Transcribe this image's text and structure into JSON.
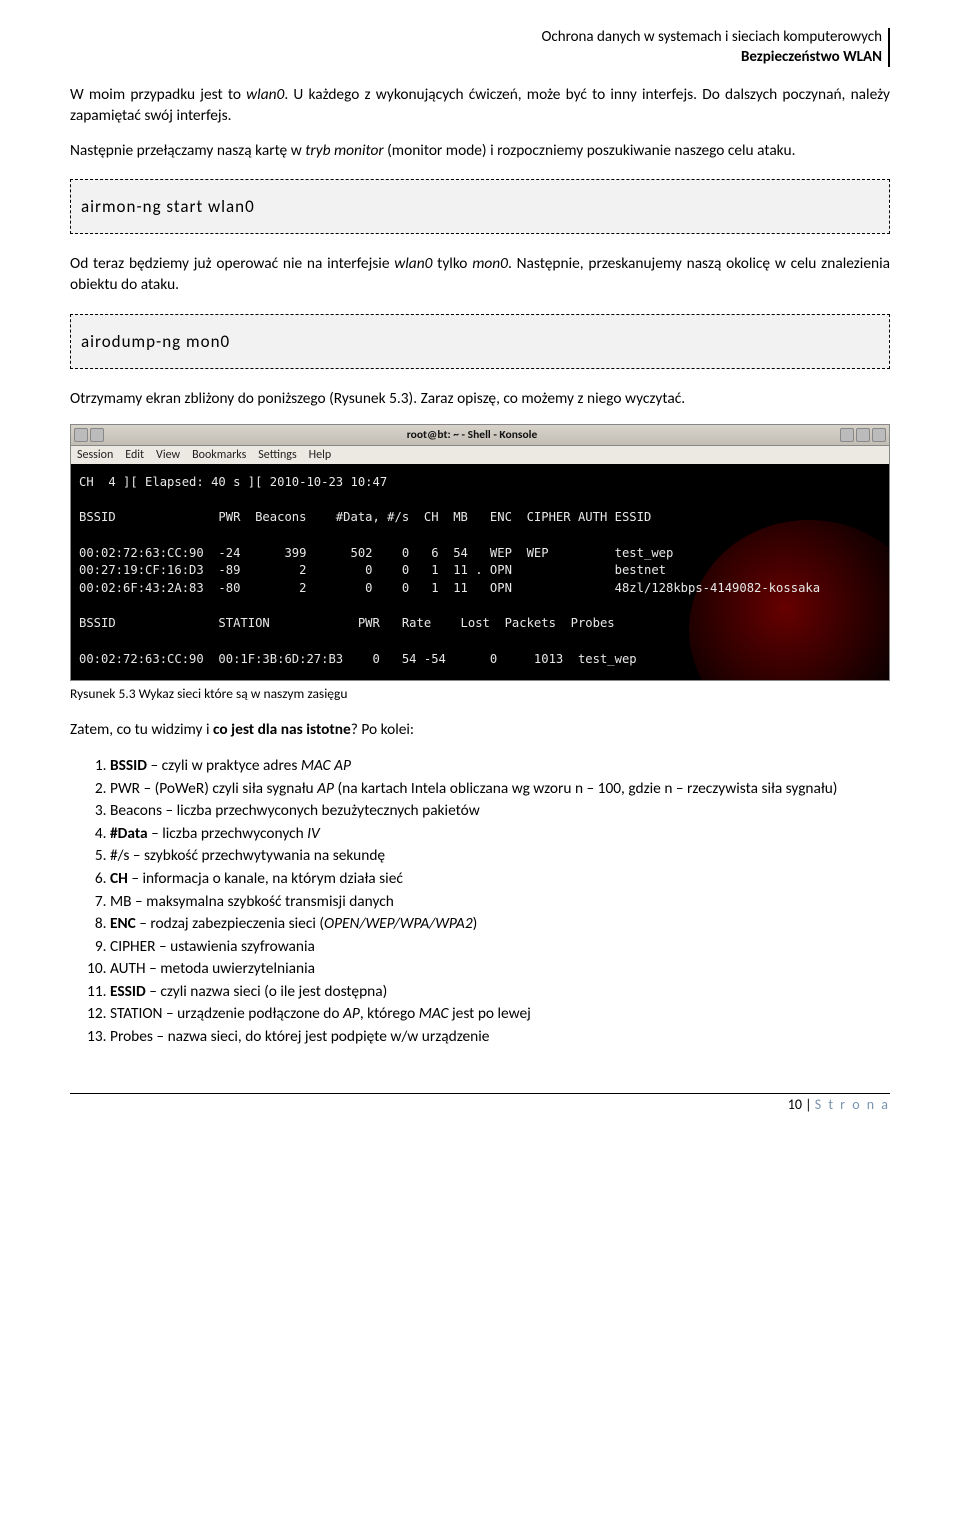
{
  "header": {
    "line1": "Ochrona danych w systemach i sieciach komputerowych",
    "line2": "Bezpieczeństwo WLAN"
  },
  "p1_a": "W moim przypadku jest to ",
  "p1_wlan": "wlan0",
  "p1_b": ". U każdego z wykonujących ćwiczeń, może być to inny interfejs. Do dalszych poczynań, należy zapamiętać swój interfejs.",
  "p2_a": "Następnie przełączamy naszą kartę w ",
  "p2_tryb": "tryb monitor",
  "p2_b": " (monitor mode) i rozpoczniemy poszukiwanie naszego celu ataku.",
  "code1": "airmon-ng  start  wlan0",
  "p3_a": "Od teraz będziemy już operować nie na interfejsie ",
  "p3_wlan": "wlan0",
  "p3_b": " tylko ",
  "p3_mon": "mon0",
  "p3_c": ". Następnie, przeskanujemy naszą okolicę w celu znalezienia obiektu do ataku.",
  "code2": "airodump-ng  mon0",
  "p4": "Otrzymamy ekran zbliżony do poniższego (Rysunek 5.3). Zaraz opiszę, co możemy z niego wyczytać.",
  "titlebar_text": "root@bt: ~ - Shell - Konsole",
  "menubar": [
    "Session",
    "Edit",
    "View",
    "Bookmarks",
    "Settings",
    "Help"
  ],
  "terminal_lines": [
    "CH  4 ][ Elapsed: 40 s ][ 2010-10-23 10:47",
    "",
    "BSSID              PWR  Beacons    #Data, #/s  CH  MB   ENC  CIPHER AUTH ESSID",
    "",
    "00:02:72:63:CC:90  -24      399      502    0   6  54   WEP  WEP         test_wep",
    "00:27:19:CF:16:D3  -89        2        0    0   1  11 . OPN              bestnet",
    "00:02:6F:43:2A:83  -80        2        0    0   1  11   OPN              48zl/128kbps-4149082-kossaka",
    "",
    "BSSID              STATION            PWR   Rate    Lost  Packets  Probes",
    "",
    "00:02:72:63:CC:90  00:1F:3B:6D:27:B3    0   54 -54      0     1013  test_wep"
  ],
  "chart_data": {
    "type": "table",
    "title": "airodump-ng output",
    "networks_columns": [
      "BSSID",
      "PWR",
      "Beacons",
      "#Data",
      "#/s",
      "CH",
      "MB",
      "ENC",
      "CIPHER",
      "AUTH",
      "ESSID"
    ],
    "networks": [
      {
        "BSSID": "00:02:72:63:CC:90",
        "PWR": -24,
        "Beacons": 399,
        "#Data": 502,
        "#/s": 0,
        "CH": 6,
        "MB": "54",
        "ENC": "WEP",
        "CIPHER": "WEP",
        "AUTH": "",
        "ESSID": "test_wep"
      },
      {
        "BSSID": "00:27:19:CF:16:D3",
        "PWR": -89,
        "Beacons": 2,
        "#Data": 0,
        "#/s": 0,
        "CH": 1,
        "MB": "11 .",
        "ENC": "OPN",
        "CIPHER": "",
        "AUTH": "",
        "ESSID": "bestnet"
      },
      {
        "BSSID": "00:02:6F:43:2A:83",
        "PWR": -80,
        "Beacons": 2,
        "#Data": 0,
        "#/s": 0,
        "CH": 1,
        "MB": "11",
        "ENC": "OPN",
        "CIPHER": "",
        "AUTH": "",
        "ESSID": "48zl/128kbps-4149082-kossaka"
      }
    ],
    "stations_columns": [
      "BSSID",
      "STATION",
      "PWR",
      "Rate",
      "Lost",
      "Packets",
      "Probes"
    ],
    "stations": [
      {
        "BSSID": "00:02:72:63:CC:90",
        "STATION": "00:1F:3B:6D:27:B3",
        "PWR": 0,
        "Rate": "54 -54",
        "Lost": 0,
        "Packets": 1013,
        "Probes": "test_wep"
      }
    ],
    "status": "CH 4 | Elapsed: 40 s | 2010-10-23 10:47"
  },
  "caption": "Rysunek 5.3 Wykaz sieci które są w naszym zasięgu",
  "list_intro_a": "Zatem, co tu widzimy i ",
  "list_intro_bold": "co jest dla nas istotne",
  "list_intro_b": "? Po kolei:",
  "fields": [
    {
      "bold": "BSSID",
      "rest": " – czyli w praktyce adres ",
      "i": "MAC AP",
      "tail": ""
    },
    {
      "plain": "PWR – (PoWeR) czyli siła sygnału ",
      "i": "AP",
      "tail": " (na kartach Intela obliczana wg wzoru n – 100, gdzie n – rzeczywista siła sygnału)"
    },
    {
      "plain": "Beacons – liczba przechwyconych bezużytecznych pakietów"
    },
    {
      "bold": "#Data",
      "rest": " – liczba przechwyconych ",
      "i": "IV",
      "tail": ""
    },
    {
      "plain": "#/s – szybkość przechwytywania na sekundę"
    },
    {
      "bold": "CH",
      "rest": " – informacja o kanale, na którym działa sieć"
    },
    {
      "plain": "MB – maksymalna szybkość transmisji danych"
    },
    {
      "bold": "ENC",
      "rest": " – rodzaj zabezpieczenia sieci (",
      "i": "OPEN/WEP/WPA/WPA2",
      "tail": ")"
    },
    {
      "plain": "CIPHER – ustawienia szyfrowania"
    },
    {
      "plain": "AUTH – metoda uwierzytelniania"
    },
    {
      "bold": "ESSID",
      "rest": " – czyli nazwa sieci (o ile jest dostępna)"
    },
    {
      "plain": "STATION – urządzenie podłączone do ",
      "i": "AP",
      "tail": ", którego ",
      "i2": "MAC",
      "tail2": " jest po lewej"
    },
    {
      "plain": "Probes – nazwa sieci, do której jest podpięte w/w urządzenie"
    }
  ],
  "footer": {
    "page": "10",
    "label": "S t r o n a"
  }
}
